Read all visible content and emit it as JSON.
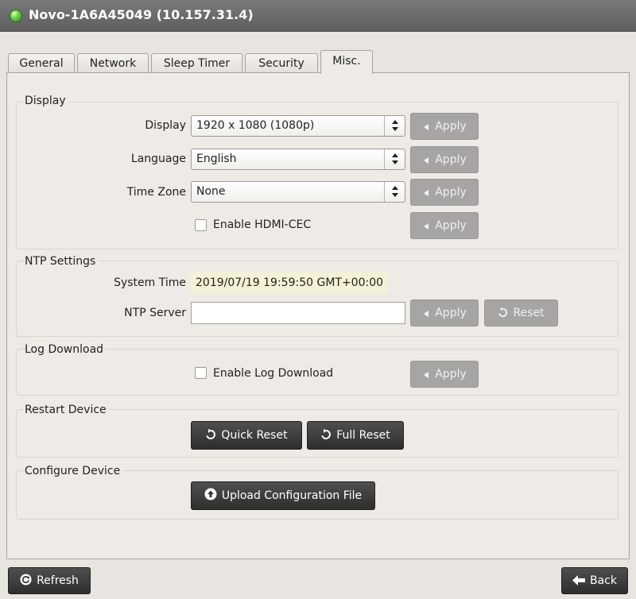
{
  "window": {
    "title": "Novo-1A6A45049 (10.157.31.4)"
  },
  "tabs": [
    {
      "label": "General"
    },
    {
      "label": "Network"
    },
    {
      "label": "Sleep Timer"
    },
    {
      "label": "Security"
    },
    {
      "label": "Misc."
    }
  ],
  "active_tab": "Misc.",
  "display": {
    "section_title": "Display",
    "display_label": "Display",
    "display_value": "1920 x 1080 (1080p)",
    "language_label": "Language",
    "language_value": "English",
    "timezone_label": "Time Zone",
    "timezone_value": "None",
    "hdmi_cec_label": "Enable HDMI-CEC",
    "hdmi_cec_checked": false,
    "apply_label": "Apply"
  },
  "ntp": {
    "section_title": "NTP Settings",
    "system_time_label": "System Time",
    "system_time_value": "2019/07/19 19:59:50 GMT+00:00",
    "server_label": "NTP Server",
    "server_value": "",
    "apply_label": "Apply",
    "reset_label": "Reset"
  },
  "log": {
    "section_title": "Log Download",
    "enable_label": "Enable Log Download",
    "enable_checked": false,
    "apply_label": "Apply"
  },
  "restart": {
    "section_title": "Restart Device",
    "quick_reset_label": "Quick Reset",
    "full_reset_label": "Full Reset"
  },
  "configure": {
    "section_title": "Configure Device",
    "upload_label": "Upload Configuration File"
  },
  "footer": {
    "refresh_label": "Refresh",
    "back_label": "Back"
  },
  "colors": {
    "status_dot": "#5ec23a",
    "titlebar": "#6b6b6b",
    "disabled_button": "#a7a5a3",
    "dark_button": "#3a3a3a",
    "system_time_bg": "#f5f1d6"
  },
  "icons": {
    "status": "green-status-dot",
    "apply": "chevron-left-icon",
    "reset": "reset-icon",
    "upload": "upload-icon",
    "refresh": "refresh-icon",
    "back": "arrow-left-icon",
    "select": "select-arrows-icon"
  }
}
